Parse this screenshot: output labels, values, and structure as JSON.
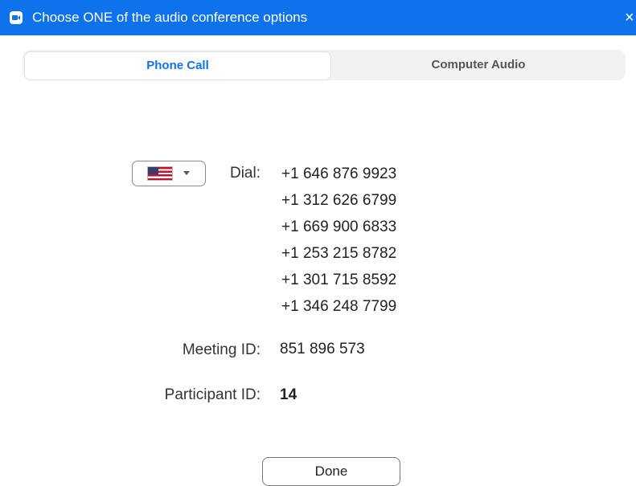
{
  "window": {
    "title": "Choose ONE of the audio conference options",
    "close_glyph": "×"
  },
  "tabs": [
    {
      "label": "Phone Call",
      "active": true
    },
    {
      "label": "Computer Audio",
      "active": false
    }
  ],
  "country_selector": {
    "flag": "US",
    "icon": "us-flag-icon"
  },
  "dial": {
    "label": "Dial:",
    "numbers": [
      "+1 646 876 9923",
      "+1 312 626 6799",
      "+1 669 900 6833",
      "+1 253 215 8782",
      "+1 301 715 8592",
      "+1 346 248 7799"
    ]
  },
  "meeting": {
    "label": "Meeting ID:",
    "value": "851 896 573"
  },
  "participant": {
    "label": "Participant ID:",
    "value": "14"
  },
  "done_button": {
    "label": "Done"
  },
  "colors": {
    "accent": "#0e72ed",
    "tab_bg": "#f2f2f4"
  }
}
